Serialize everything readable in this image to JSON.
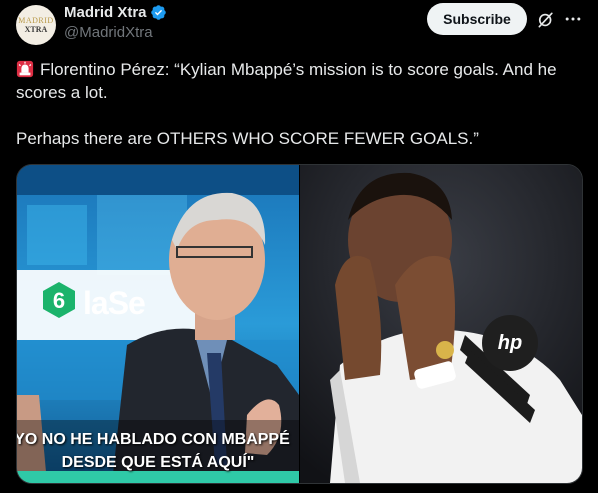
{
  "author": {
    "display_name": "Madrid Xtra",
    "handle": "@MadridXtra",
    "avatar_line1": "MADRID",
    "avatar_line2": "XTRA"
  },
  "actions": {
    "subscribe_label": "Subscribe"
  },
  "tweet": {
    "line1": "Florentino Pérez: “Kylian Mbappé’s mission is to score goals. And he scores a lot.",
    "line2": "Perhaps there are OTHERS WHO SCORE FEWER GOALS.”"
  },
  "media": {
    "left_caption_line1": "YO NO HE HABLADO CON MBAPPÉ",
    "left_caption_line2": "DESDE QUE ESTÁ AQUÍ\"",
    "broadcast_logo_text": "laSe",
    "broadcast_logo_number": "6",
    "shirt_sponsor": "hp"
  },
  "icons": {
    "verified": "verified-badge-icon",
    "grok": "grok-icon",
    "more": "more-icon",
    "siren": "police-light-emoji"
  },
  "colors": {
    "background": "#000000",
    "text": "#e7e9ea",
    "secondary_text": "#71767b",
    "verified_blue": "#1d9bf0",
    "subscribe_bg": "#eff3f4"
  }
}
